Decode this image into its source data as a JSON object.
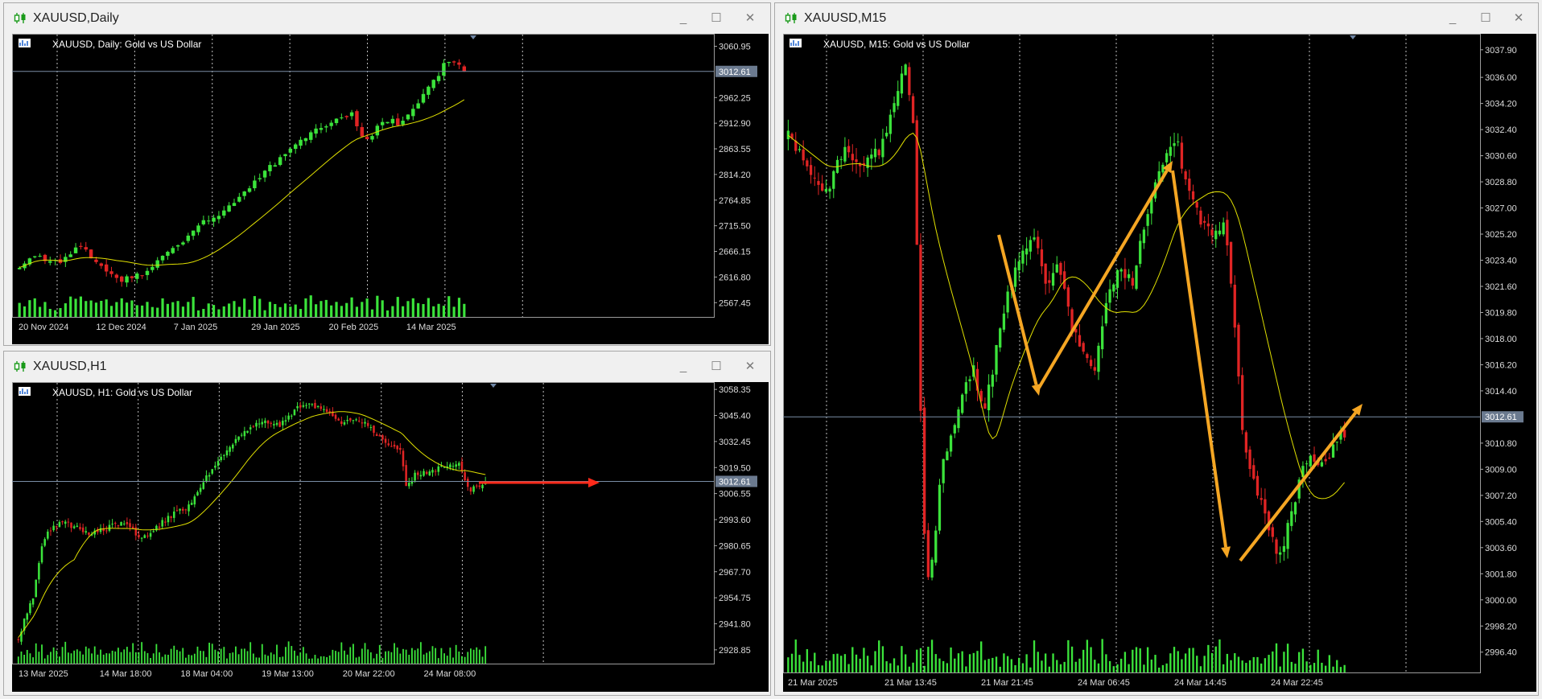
{
  "colors": {
    "bull": "#3be33b",
    "bear": "#e02424",
    "ma": "#e0e000",
    "grid": "#bfbfbf",
    "price_line": "#7a8ea6",
    "price_badge": "#6b7a8f",
    "arrow_orange": "#f5a623",
    "arrow_red": "#ff2a1a"
  },
  "window_controls": {
    "minimize": "_",
    "maximize": "☐",
    "close": "✕"
  },
  "windows": [
    {
      "key": "daily",
      "title": "XAUUSD,Daily",
      "info": "XAUUSD, Daily:  Gold vs US Dollar",
      "current_price": "3012.61",
      "chart_data": {
        "type": "candlestick",
        "timeframe": "Daily",
        "price_axis": [
          "3060.95",
          "3012.61",
          "2962.25",
          "2912.90",
          "2863.55",
          "2814.20",
          "2764.85",
          "2715.50",
          "2666.15",
          "2616.80",
          "2567.45"
        ],
        "ylim": [
          2540,
          3085
        ],
        "time_axis": [
          "20 Nov 2024",
          "12 Dec 2024",
          "7 Jan 2025",
          "29 Jan 2025",
          "20 Feb 2025",
          "14 Mar 2025"
        ],
        "n_bars": 88,
        "anchors": [
          [
            0,
            2635
          ],
          [
            4,
            2660
          ],
          [
            10,
            2640
          ],
          [
            14,
            2680
          ],
          [
            18,
            2650
          ],
          [
            22,
            2625
          ],
          [
            24,
            2610
          ],
          [
            30,
            2625
          ],
          [
            34,
            2655
          ],
          [
            40,
            2690
          ],
          [
            44,
            2720
          ],
          [
            48,
            2735
          ],
          [
            52,
            2760
          ],
          [
            56,
            2795
          ],
          [
            60,
            2825
          ],
          [
            64,
            2858
          ],
          [
            70,
            2895
          ],
          [
            74,
            2910
          ],
          [
            78,
            2925
          ],
          [
            80,
            2935
          ],
          [
            82,
            2895
          ],
          [
            84,
            2880
          ],
          [
            86,
            2910
          ],
          [
            88,
            2920
          ],
          [
            92,
            2912
          ],
          [
            96,
            2955
          ],
          [
            100,
            2995
          ],
          [
            102,
            3025
          ],
          [
            104,
            3038
          ],
          [
            106,
            3022
          ],
          [
            107,
            3014
          ]
        ],
        "ma_period": 20,
        "vol_range": [
          8,
          30
        ]
      }
    },
    {
      "key": "h1",
      "title": "XAUUSD,H1",
      "info": "XAUUSD, H1:  Gold vs US Dollar",
      "current_price": "3012.61",
      "chart_data": {
        "type": "candlestick",
        "timeframe": "H1",
        "price_axis": [
          "3058.35",
          "3045.40",
          "3032.45",
          "3019.50",
          "3012.61",
          "3006.55",
          "2993.60",
          "2980.65",
          "2967.70",
          "2954.75",
          "2941.80",
          "2928.85"
        ],
        "ylim": [
          2922,
          3062
        ],
        "time_axis": [
          "13 Mar 2025",
          "14 Mar 18:00",
          "18 Mar 04:00",
          "19 Mar 13:00",
          "20 Mar 22:00",
          "24 Mar 08:00"
        ],
        "n_bars": 160,
        "anchors": [
          [
            0,
            2935
          ],
          [
            6,
            2955
          ],
          [
            10,
            2982
          ],
          [
            14,
            2990
          ],
          [
            18,
            2992
          ],
          [
            24,
            2990
          ],
          [
            30,
            2986
          ],
          [
            38,
            2990
          ],
          [
            44,
            2992
          ],
          [
            50,
            2985
          ],
          [
            56,
            2988
          ],
          [
            62,
            2995
          ],
          [
            70,
            3000
          ],
          [
            76,
            3012
          ],
          [
            84,
            3025
          ],
          [
            92,
            3037
          ],
          [
            100,
            3042
          ],
          [
            108,
            3040
          ],
          [
            114,
            3048
          ],
          [
            120,
            3052
          ],
          [
            128,
            3046
          ],
          [
            134,
            3042
          ],
          [
            140,
            3044
          ],
          [
            148,
            3036
          ],
          [
            154,
            3030
          ],
          [
            158,
            3028
          ],
          [
            160,
            3010
          ],
          [
            164,
            3016
          ],
          [
            170,
            3018
          ],
          [
            176,
            3020
          ],
          [
            182,
            3022
          ],
          [
            186,
            3008
          ],
          [
            190,
            3010
          ],
          [
            193,
            3012
          ]
        ],
        "ma_period": 20,
        "vol_range": [
          6,
          28
        ]
      }
    },
    {
      "key": "m15",
      "title": "XAUUSD,M15",
      "info": "XAUUSD, M15:  Gold vs US Dollar",
      "current_price": "3012.61",
      "chart_data": {
        "type": "candlestick",
        "timeframe": "M15",
        "price_axis": [
          "3037.90",
          "3036.00",
          "3034.20",
          "3032.40",
          "3030.60",
          "3028.80",
          "3027.00",
          "3025.20",
          "3023.40",
          "3021.60",
          "3019.80",
          "3018.00",
          "3016.20",
          "3014.40",
          "3012.61",
          "3010.80",
          "3009.00",
          "3007.20",
          "3005.40",
          "3003.60",
          "3001.80",
          "3000.00",
          "2998.20",
          "2996.40"
        ],
        "ylim": [
          2995,
          3039
        ],
        "time_axis": [
          "21 Mar 2025",
          "21 Mar 13:45",
          "21 Mar 21:45",
          "24 Mar 06:45",
          "24 Mar 14:45",
          "24 Mar 22:45"
        ],
        "n_bars": 148,
        "anchors": [
          [
            0,
            3032
          ],
          [
            6,
            3030
          ],
          [
            12,
            3028
          ],
          [
            18,
            3031
          ],
          [
            24,
            3030
          ],
          [
            30,
            3031
          ],
          [
            34,
            3034
          ],
          [
            38,
            3037
          ],
          [
            41,
            3032
          ],
          [
            44,
            3005
          ],
          [
            46,
            3001
          ],
          [
            50,
            3009
          ],
          [
            54,
            3012
          ],
          [
            60,
            3016
          ],
          [
            64,
            3013
          ],
          [
            70,
            3020
          ],
          [
            76,
            3024
          ],
          [
            80,
            3025
          ],
          [
            84,
            3022
          ],
          [
            88,
            3023
          ],
          [
            92,
            3019
          ],
          [
            96,
            3017
          ],
          [
            100,
            3016
          ],
          [
            104,
            3021
          ],
          [
            108,
            3023
          ],
          [
            112,
            3022
          ],
          [
            118,
            3028
          ],
          [
            122,
            3030
          ],
          [
            126,
            3032
          ],
          [
            128,
            3030
          ],
          [
            134,
            3026
          ],
          [
            138,
            3025
          ],
          [
            142,
            3026
          ],
          [
            144,
            3022
          ],
          [
            148,
            3011
          ],
          [
            152,
            3008
          ],
          [
            156,
            3005
          ],
          [
            160,
            3003
          ],
          [
            164,
            3006
          ],
          [
            168,
            3010
          ],
          [
            172,
            3009
          ],
          [
            176,
            3010
          ],
          [
            180,
            3012
          ],
          [
            181,
            3011
          ]
        ],
        "ma_period": 20,
        "vol_range": [
          6,
          42
        ]
      },
      "annotations": [
        "orange-trend-arrows"
      ]
    }
  ]
}
